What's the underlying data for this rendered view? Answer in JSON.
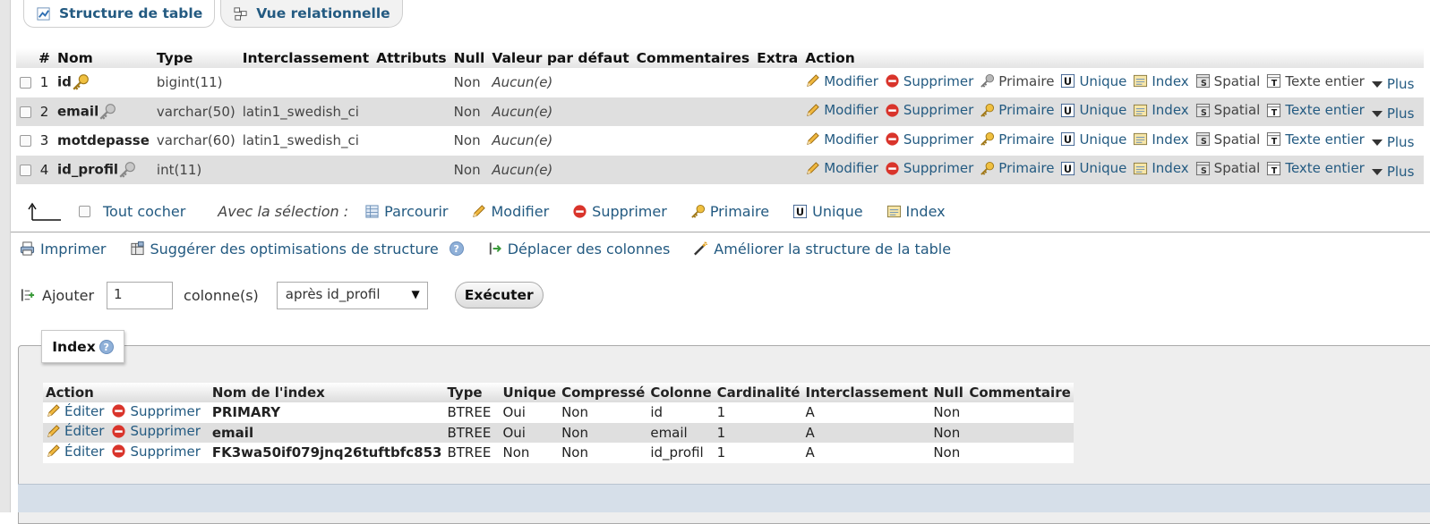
{
  "tabs": [
    {
      "label": "Structure de table",
      "icon": "table-structure-icon"
    },
    {
      "label": "Vue relationnelle",
      "icon": "relation-view-icon"
    }
  ],
  "structure": {
    "headers": [
      "#",
      "Nom",
      "Type",
      "Interclassement",
      "Attributs",
      "Null",
      "Valeur par défaut",
      "Commentaires",
      "Extra",
      "Action"
    ],
    "rows": [
      {
        "num": "1",
        "name": "id",
        "key": "primary",
        "type": "bigint(11)",
        "collation": "",
        "attributes": "",
        "null": "Non",
        "default": "Aucun(e)",
        "comments": "",
        "extra": "",
        "primary_disabled": true
      },
      {
        "num": "2",
        "name": "email",
        "key": "index",
        "type": "varchar(50)",
        "collation": "latin1_swedish_ci",
        "attributes": "",
        "null": "Non",
        "default": "Aucun(e)",
        "comments": "",
        "extra": "",
        "primary_disabled": false
      },
      {
        "num": "3",
        "name": "motdepasse",
        "key": "",
        "type": "varchar(60)",
        "collation": "latin1_swedish_ci",
        "attributes": "",
        "null": "Non",
        "default": "Aucun(e)",
        "comments": "",
        "extra": "",
        "primary_disabled": false
      },
      {
        "num": "4",
        "name": "id_profil",
        "key": "index",
        "type": "int(11)",
        "collation": "",
        "attributes": "",
        "null": "Non",
        "default": "Aucun(e)",
        "comments": "",
        "extra": "",
        "primary_disabled": false
      }
    ],
    "actions": {
      "modifier": "Modifier",
      "supprimer": "Supprimer",
      "primaire": "Primaire",
      "unique": "Unique",
      "index": "Index",
      "spatial": "Spatial",
      "texte": "Texte entier",
      "plus": "Plus"
    }
  },
  "selection": {
    "check_all": "Tout cocher",
    "with_selection": "Avec la sélection :",
    "items": [
      "Parcourir",
      "Modifier",
      "Supprimer",
      "Primaire",
      "Unique",
      "Index"
    ]
  },
  "tools": {
    "print": "Imprimer",
    "suggest": "Suggérer des optimisations de structure",
    "move": "Déplacer des colonnes",
    "improve": "Améliorer la structure de la table"
  },
  "add_column": {
    "label": "Ajouter",
    "count": "1",
    "unit": "colonne(s)",
    "position": "après id_profil",
    "execute": "Exécuter"
  },
  "index_panel": {
    "legend": "Index",
    "headers": [
      "Action",
      "Nom de l'index",
      "Type",
      "Unique",
      "Compressé",
      "Colonne",
      "Cardinalité",
      "Interclassement",
      "Null",
      "Commentaire"
    ],
    "edit_label": "Éditer",
    "delete_label": "Supprimer",
    "rows": [
      {
        "name": "PRIMARY",
        "type": "BTREE",
        "unique": "Oui",
        "packed": "Non",
        "column": "id",
        "cardinality": "1",
        "collation": "A",
        "null": "Non",
        "comment": ""
      },
      {
        "name": "email",
        "type": "BTREE",
        "unique": "Oui",
        "packed": "Non",
        "column": "email",
        "cardinality": "1",
        "collation": "A",
        "null": "Non",
        "comment": ""
      },
      {
        "name": "FK3wa50if079jnq26tuftbfc853",
        "type": "BTREE",
        "unique": "Non",
        "packed": "Non",
        "column": "id_profil",
        "cardinality": "1",
        "collation": "A",
        "null": "Non",
        "comment": ""
      }
    ]
  },
  "colors": {
    "link": "#235a81",
    "row_alt": "#dfdfdf",
    "delete_red": "#d9342b",
    "key_gold": "#e0a020"
  }
}
